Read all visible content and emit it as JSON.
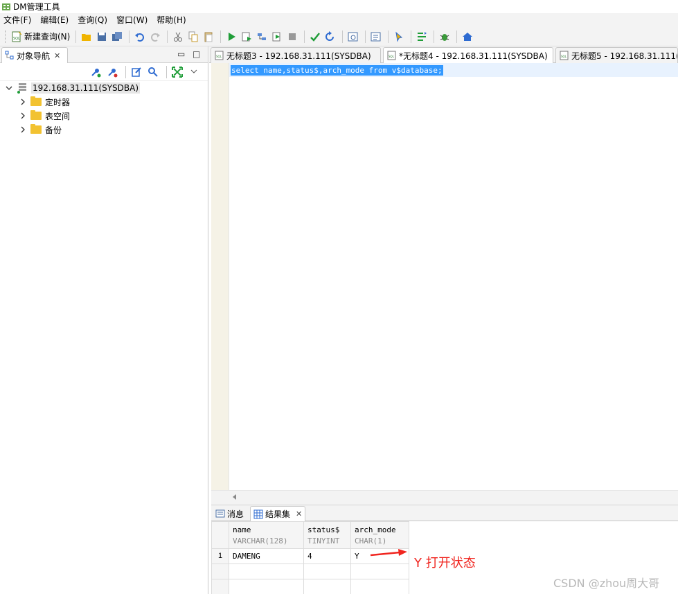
{
  "window": {
    "title": "DM管理工具"
  },
  "menu": {
    "items": [
      "文件(F)",
      "编辑(E)",
      "查询(Q)",
      "窗口(W)",
      "帮助(H)"
    ]
  },
  "toolbar": {
    "new_query_label": "新建查询(N)",
    "icons": [
      "open-folder-icon",
      "save-icon",
      "save-all-icon",
      "undo-icon",
      "redo-icon",
      "cut-icon",
      "copy-icon",
      "paste-icon",
      "run-icon",
      "run-script-icon",
      "explain-icon",
      "run-to-cursor-icon",
      "stop-icon",
      "commit-icon",
      "rollback-icon",
      "query-plan-icon",
      "sql-log-icon",
      "hint-icon",
      "arrange-icon",
      "debug-icon",
      "home-icon"
    ]
  },
  "object_nav": {
    "tab_label": "对象导航",
    "tree": {
      "root": "192.168.31.111(SYSDBA)",
      "children": [
        "定时器",
        "表空间",
        "备份"
      ]
    }
  },
  "editor_tabs": [
    {
      "label": "无标题3 - 192.168.31.111(SYSDBA)",
      "active": false
    },
    {
      "label": "*无标题4 - 192.168.31.111(SYSDBA)",
      "active": true
    },
    {
      "label": "无标题5 - 192.168.31.111(SY",
      "active": false
    }
  ],
  "editor": {
    "sql": "select name,status$,arch_mode from v$database;"
  },
  "result_tabs": {
    "messages_label": "消息",
    "resultset_label": "结果集"
  },
  "result_grid": {
    "columns": [
      {
        "name": "name",
        "type": "VARCHAR(128)"
      },
      {
        "name": "status$",
        "type": "TINYINT"
      },
      {
        "name": "arch_mode",
        "type": "CHAR(1)"
      }
    ],
    "rows": [
      {
        "num": "1",
        "cells": [
          "DAMENG",
          "4",
          "Y"
        ]
      }
    ]
  },
  "annotation": {
    "text": "Y 打开状态",
    "color": "#f0251f"
  },
  "watermark": "CSDN @zhou周大哥"
}
